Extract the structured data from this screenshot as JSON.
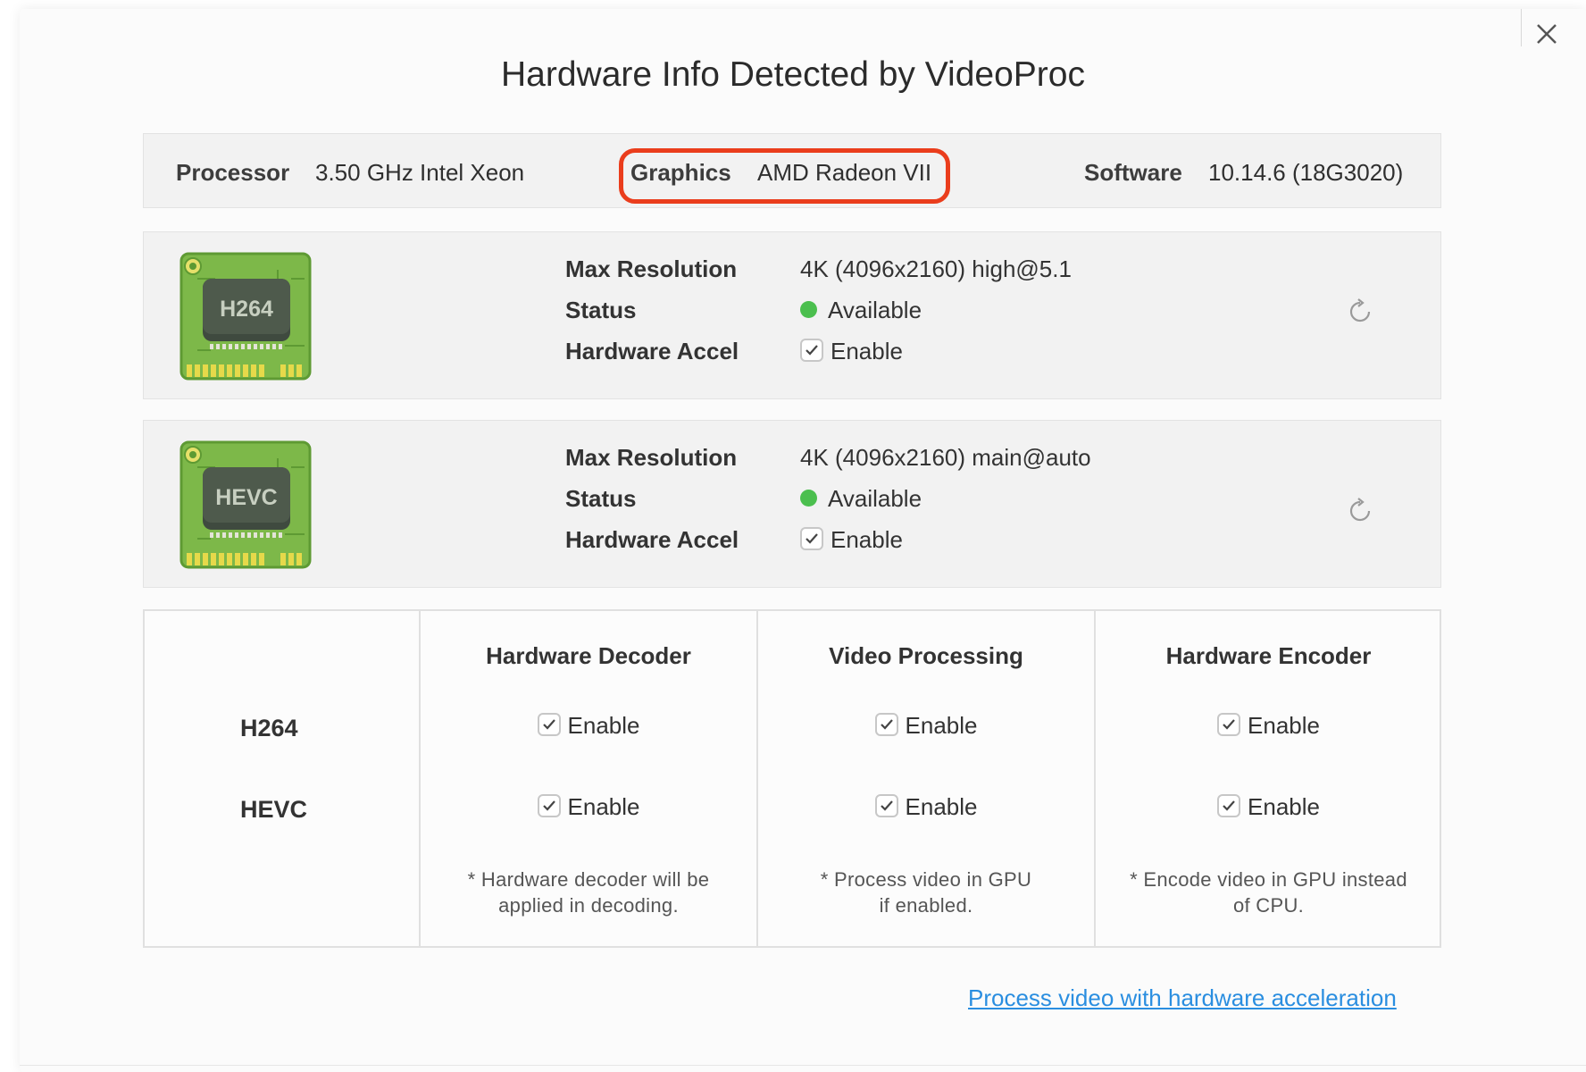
{
  "dialog": {
    "title": "Hardware Info Detected by VideoProc",
    "close_icon": "close-icon"
  },
  "info_bar": {
    "processor_label": "Processor",
    "processor_value": "3.50 GHz Intel Xeon",
    "graphics_label": "Graphics",
    "graphics_value": "AMD Radeon VII",
    "software_label": "Software",
    "software_value": "10.14.6 (18G3020)",
    "highlight_color": "#ea3d1c"
  },
  "cards": [
    {
      "chip_label": "H264",
      "max_res_label": "Max Resolution",
      "max_res_value": "4K (4096x2160) high@5.1",
      "status_label": "Status",
      "status_value": "Available",
      "accel_label": "Hardware Accel",
      "accel_value": "Enable",
      "accel_checked": true,
      "status_color": "#4bbf4e"
    },
    {
      "chip_label": "HEVC",
      "max_res_label": "Max Resolution",
      "max_res_value": "4K (4096x2160) main@auto",
      "status_label": "Status",
      "status_value": "Available",
      "accel_label": "Hardware Accel",
      "accel_value": "Enable",
      "accel_checked": true,
      "status_color": "#4bbf4e"
    }
  ],
  "table": {
    "headers": [
      "Hardware Decoder",
      "Video Processing",
      "Hardware Encoder"
    ],
    "rows": [
      {
        "name": "H264",
        "cells": [
          "Enable",
          "Enable",
          "Enable"
        ]
      },
      {
        "name": "HEVC",
        "cells": [
          "Enable",
          "Enable",
          "Enable"
        ]
      }
    ],
    "notes": [
      [
        "* Hardware decoder will be",
        "applied in decoding."
      ],
      [
        "* Process video in GPU",
        "if enabled."
      ],
      [
        "* Encode video in GPU instead",
        "of CPU."
      ]
    ]
  },
  "footer": {
    "link_text": "Process video with hardware acceleration",
    "link_color": "#2a8ee0"
  }
}
